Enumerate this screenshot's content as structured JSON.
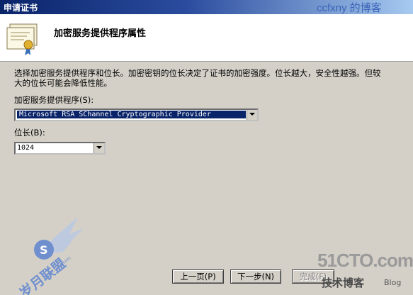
{
  "window": {
    "title": "申请证书"
  },
  "watermarks": {
    "top_right": "ccfxny 的博客",
    "left_logo_text": "岁月联盟",
    "left_logo_url": "www.syue.com",
    "right_logo_big": "51CTO.com",
    "right_logo_small": "技术博客",
    "right_logo_blog": "Blog"
  },
  "header": {
    "title": "加密服务提供程序属性",
    "icon": "certificate-icon"
  },
  "content": {
    "description": "选择加密服务提供程序和位长。加密密钥的位长决定了证书的加密强度。位长越大，安全性越强。但较大的位长可能会降低性能。",
    "csp_label": "加密服务提供程序(S):",
    "csp_value": "Microsoft RSA SChannel Cryptographic Provider",
    "bitlen_label": "位长(B):",
    "bitlen_value": "1024"
  },
  "buttons": {
    "back": "上一页(P)",
    "next": "下一步(N)",
    "finish": "完成(F)"
  },
  "colors": {
    "titlebar": "#0a246a",
    "selection": "#0a246a",
    "dialog_bg": "#d4d0c8"
  }
}
